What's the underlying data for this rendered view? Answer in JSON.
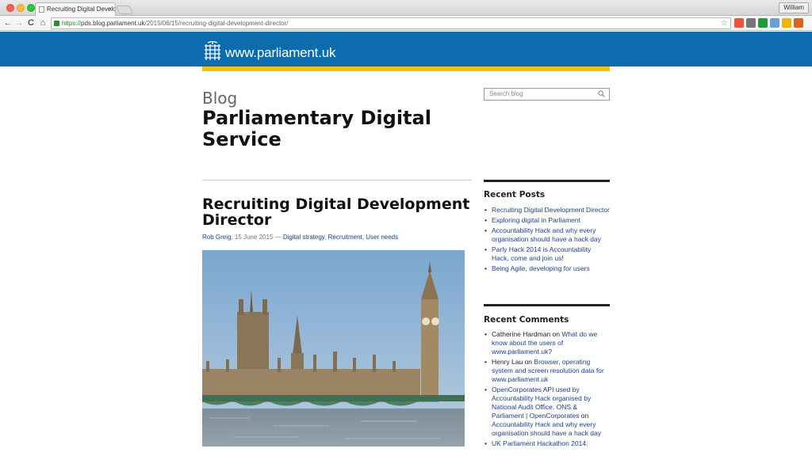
{
  "browser": {
    "tab_title": "Recruiting Digital Develop",
    "tab_close": "×",
    "user_name": "William",
    "url_scheme": "https://",
    "url_host": "pds.blog.parliament.uk",
    "url_path": "/2015/06/15/recruiting-digital-development-director/",
    "nav": {
      "back": "←",
      "forward": "→",
      "reload": "C",
      "home": "⌂"
    },
    "star": "☆",
    "extensions": [
      {
        "name": "pocket-icon",
        "color": "#e8553a"
      },
      {
        "name": "cast-icon",
        "color": "#777777"
      },
      {
        "name": "run-icon",
        "color": "#1f9a3a"
      },
      {
        "name": "tidy-icon",
        "color": "#6aa0d8"
      },
      {
        "name": "drive-icon",
        "color": "#f2b200"
      },
      {
        "name": "menu-icon",
        "color": "#d9641e"
      }
    ]
  },
  "site": {
    "logo_text": "www.parliament.uk",
    "header_color": "#0d6cad",
    "accent_color": "#f3c300"
  },
  "blog": {
    "kicker": "Blog",
    "title": "Parliamentary Digital Service",
    "search_placeholder": "Search blog"
  },
  "post": {
    "title": "Recruiting Digital Development Director",
    "author": "Rob Greig",
    "date": ", 15 June 2015 — ",
    "categories": [
      "Digital strategy",
      "Recruitment",
      "User needs"
    ],
    "image_alt": "Houses of Parliament and Big Ben"
  },
  "sidebar": {
    "recent_posts_title": "Recent Posts",
    "recent_posts": [
      "Recruiting Digital Development Director",
      "Exploring digital in Parliament",
      "Accountability Hack and why every organisation should have a hack day",
      "Parly Hack 2014 is Accountability Hack, come and join us!",
      "Being Agile, developing for users"
    ],
    "recent_comments_title": "Recent Comments",
    "recent_comments": [
      {
        "author": "Catherine Hardman",
        "on": " on ",
        "post": "What do we know about the users of www.parliament.uk?",
        "author_link": false
      },
      {
        "author": "Henry Lau",
        "on": " on ",
        "post": "Browser, operating system and screen resolution data for www.parliament.uk",
        "author_link": false
      },
      {
        "author": "OpenCorporates API used by Accountability Hack organised by National Audit Office, ONS & Parliament | OpenCorporates",
        "on": " on ",
        "post": "Accountability Hack and why every organisation should have a hack day",
        "author_link": true
      },
      {
        "author": "UK Parliament Hackathon 2014:",
        "on": "",
        "post": "",
        "author_link": true
      }
    ]
  }
}
